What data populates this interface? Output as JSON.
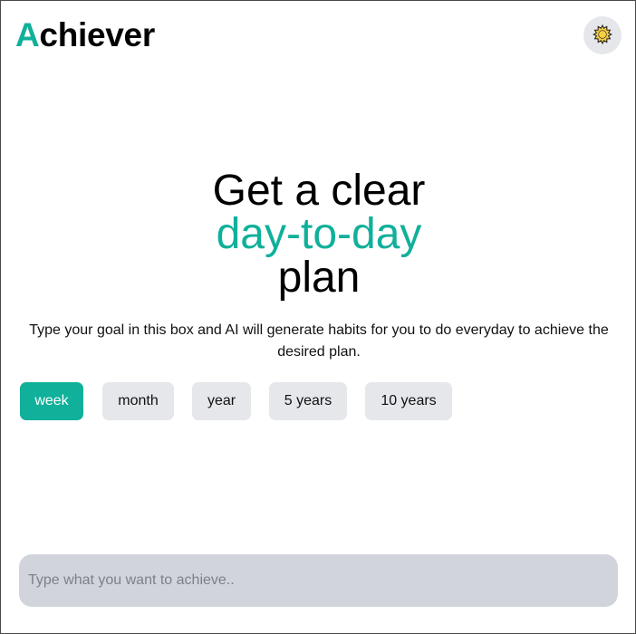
{
  "header": {
    "logo_accent": "A",
    "logo_rest": "chiever",
    "theme_toggle_icon": "sun-icon"
  },
  "hero": {
    "line1": "Get a clear",
    "line2": "day-to-day",
    "line3": "plan"
  },
  "subtitle": "Type your goal in this box and AI will generate habits for you to do everyday to achieve the desired plan.",
  "periods": [
    {
      "label": "week",
      "selected": true
    },
    {
      "label": "month",
      "selected": false
    },
    {
      "label": "year",
      "selected": false
    },
    {
      "label": "5 years",
      "selected": false
    },
    {
      "label": "10 years",
      "selected": false
    }
  ],
  "goal_input": {
    "placeholder": "Type what you want to achieve..",
    "value": ""
  },
  "colors": {
    "accent": "#10b09a",
    "chip_bg": "#e5e7eb",
    "input_bg": "#d1d5db"
  }
}
